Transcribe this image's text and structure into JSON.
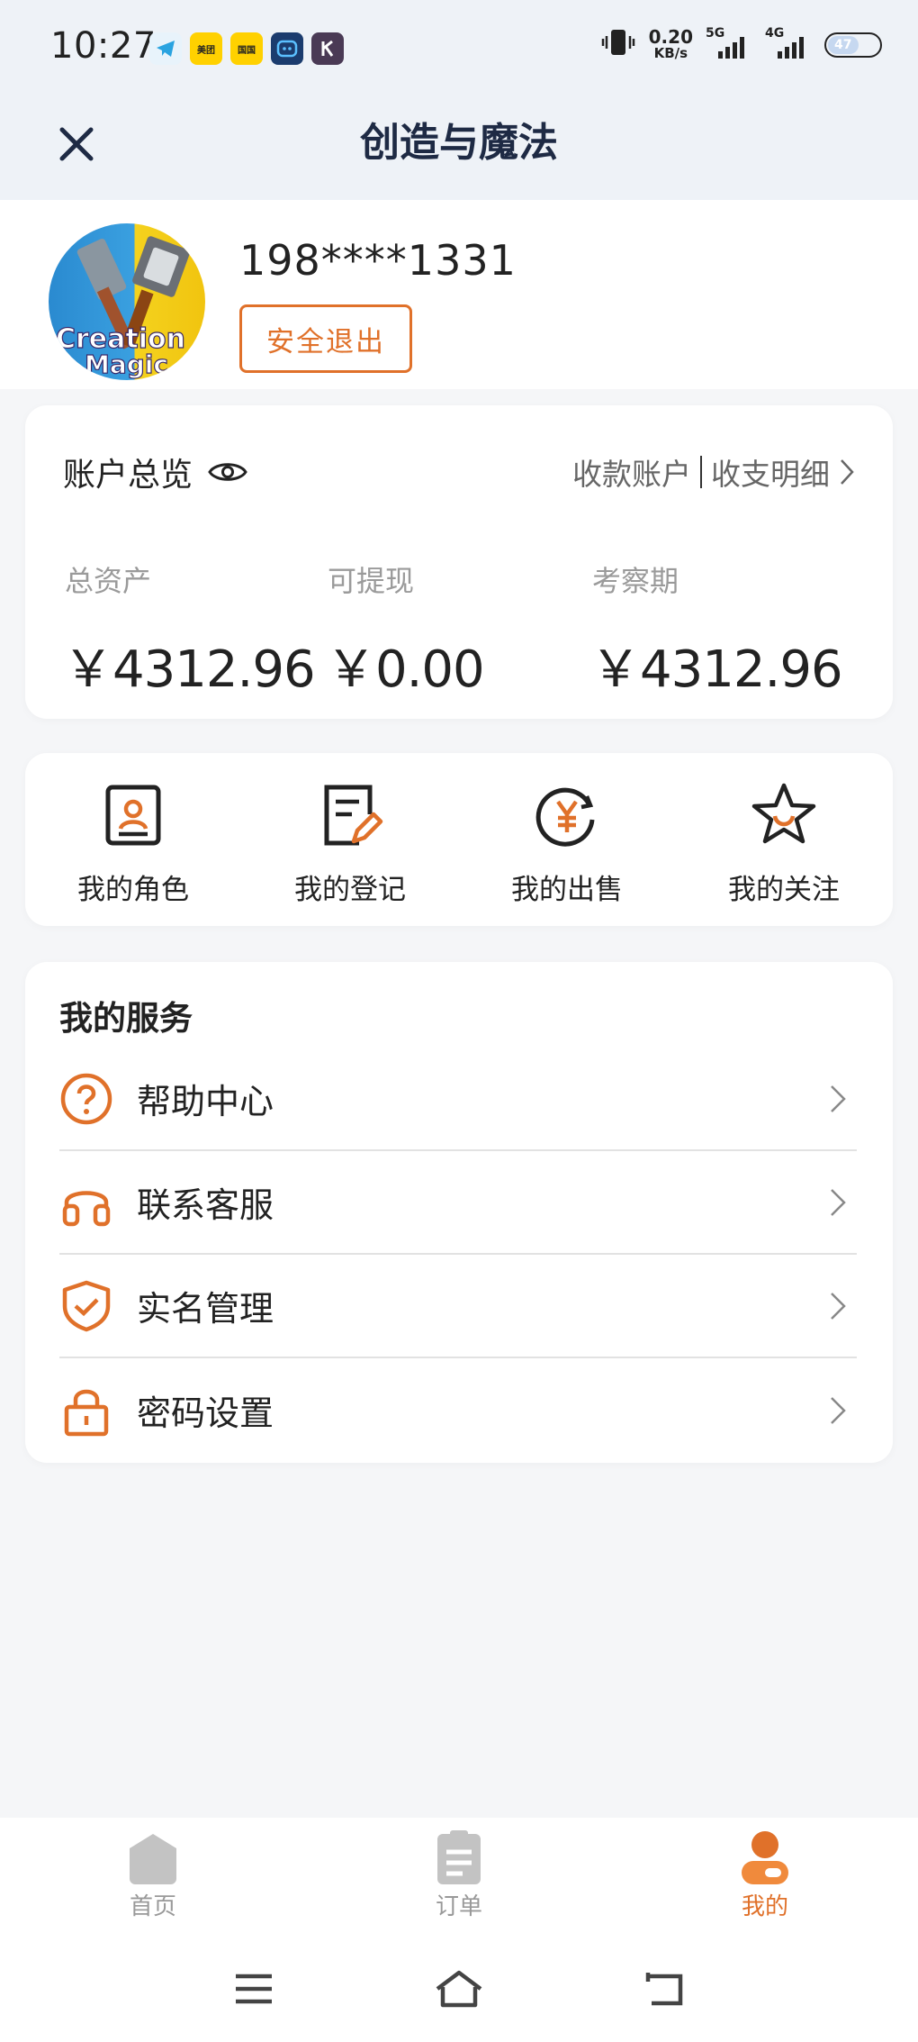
{
  "status_bar": {
    "time": "10:27",
    "net_speed_value": "0.20",
    "net_speed_unit": "KB/s",
    "signal1_label": "5G",
    "signal2_label": "4G",
    "battery_level": "47",
    "app_icons": [
      "telegram-icon",
      "meituan-icon",
      "app-icon",
      "app-icon",
      "k-app-icon"
    ],
    "app_icon_texts": [
      "美团",
      "国国"
    ]
  },
  "nav": {
    "title": "创造与魔法"
  },
  "profile": {
    "phone": "198****1331",
    "logout_label": "安全退出",
    "avatar_text_line1": "Creation",
    "avatar_text_line2": "Magic"
  },
  "account": {
    "title": "账户总览",
    "link_payee": "收款账户",
    "link_details": "收支明细",
    "stats": [
      {
        "label": "总资产",
        "value": "￥4312.96"
      },
      {
        "label": "可提现",
        "value": "￥0.00"
      },
      {
        "label": "考察期",
        "value": "￥4312.96"
      }
    ]
  },
  "quick_actions": [
    {
      "label": "我的角色",
      "icon": "role-card-icon"
    },
    {
      "label": "我的登记",
      "icon": "register-edit-icon"
    },
    {
      "label": "我的出售",
      "icon": "sell-yen-icon"
    },
    {
      "label": "我的关注",
      "icon": "star-icon"
    }
  ],
  "services": {
    "title": "我的服务",
    "items": [
      {
        "label": "帮助中心",
        "icon": "help-icon"
      },
      {
        "label": "联系客服",
        "icon": "headset-icon"
      },
      {
        "label": "实名管理",
        "icon": "shield-check-icon"
      },
      {
        "label": "密码设置",
        "icon": "lock-icon"
      }
    ]
  },
  "tabbar": {
    "items": [
      {
        "label": "首页",
        "icon": "home-icon",
        "active": false
      },
      {
        "label": "订单",
        "icon": "order-icon",
        "active": false
      },
      {
        "label": "我的",
        "icon": "user-icon",
        "active": true
      }
    ]
  },
  "colors": {
    "accent": "#e0712a",
    "tab_inactive": "#bbbbbb",
    "nav_bg": "#eef2f7",
    "page_bg": "#f5f6f8"
  }
}
